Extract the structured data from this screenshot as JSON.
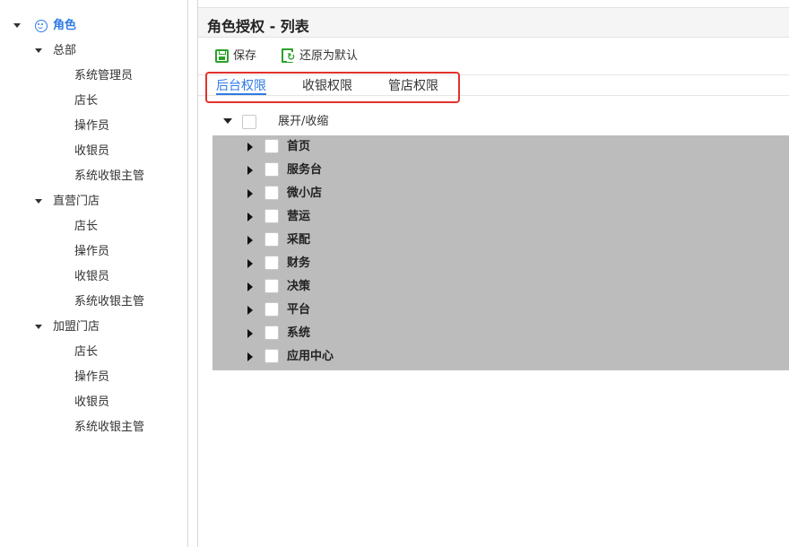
{
  "sidebar": {
    "root_label": "角色",
    "groups": [
      {
        "label": "总部",
        "items": [
          "系统管理员",
          "店长",
          "操作员",
          "收银员",
          "系统收银主管"
        ]
      },
      {
        "label": "直营门店",
        "items": [
          "店长",
          "操作员",
          "收银员",
          "系统收银主管"
        ]
      },
      {
        "label": "加盟门店",
        "items": [
          "店长",
          "操作员",
          "收银员",
          "系统收银主管"
        ]
      }
    ]
  },
  "panel": {
    "title": "角色授权 - 列表",
    "toolbar": {
      "save_label": "保存",
      "restore_label": "还原为默认"
    },
    "tabs": [
      "后台权限",
      "收银权限",
      "管店权限"
    ],
    "active_tab": "后台权限",
    "expand_label": "展开/收缩",
    "permissions": [
      "首页",
      "服务台",
      "微小店",
      "营运",
      "采配",
      "财务",
      "决策",
      "平台",
      "系统",
      "应用中心"
    ]
  },
  "colors": {
    "accent": "#2f7ae5",
    "highlight_border": "#e5312c",
    "icon_green": "#2aa12a",
    "permission_area_bg": "#bcbcbc"
  }
}
